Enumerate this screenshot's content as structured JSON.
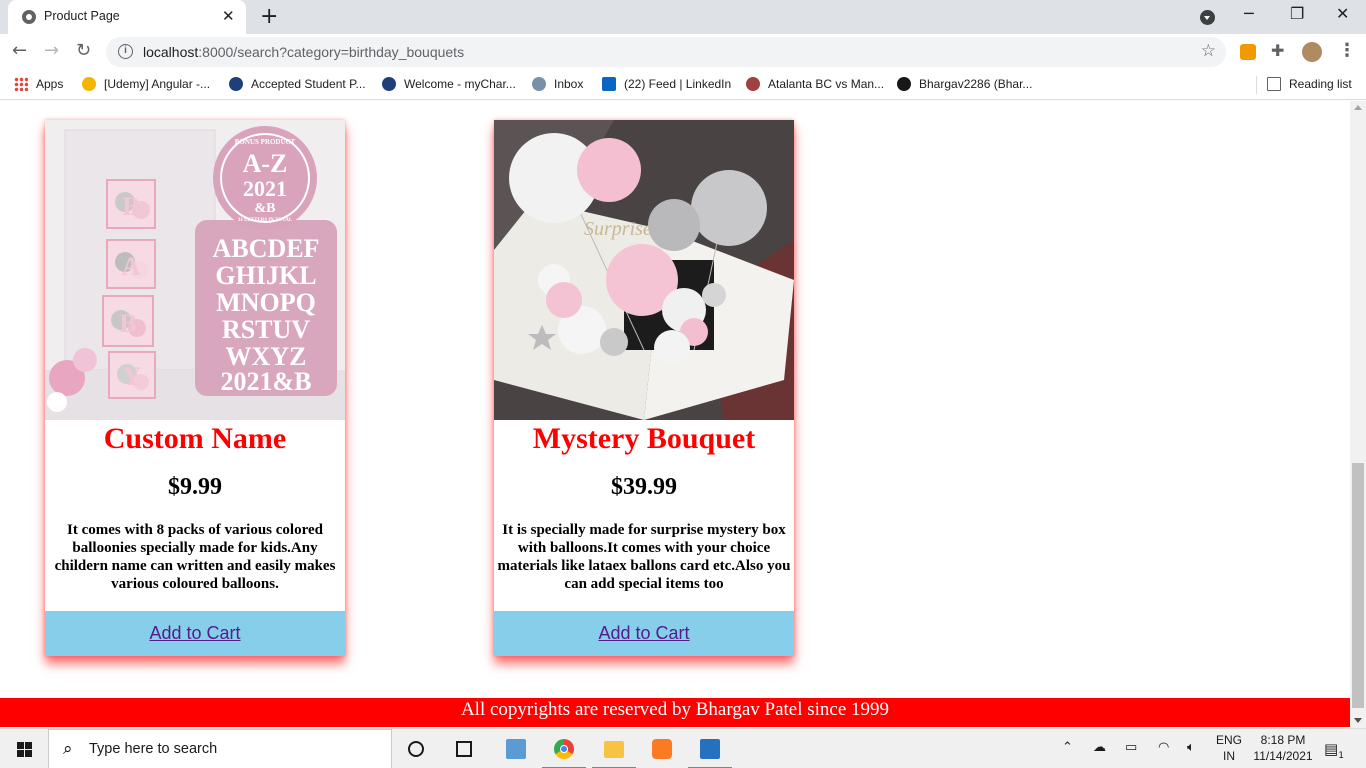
{
  "browser": {
    "tab_title": "Product Page",
    "tab_close": "✕",
    "new_tab": "+",
    "url_host": "localhost",
    "url_rest": ":8000/search?category=birthday_bouquets",
    "minimize": "─",
    "restore": "❐",
    "close": "✕",
    "bookmarks": [
      {
        "label": "Apps",
        "icon": "apps-grid-icon",
        "color": "#4285f4"
      },
      {
        "label": "[Udemy] Angular -...",
        "icon": "lightbulb-icon",
        "color": "#f4b400"
      },
      {
        "label": "Accepted Student P...",
        "icon": "university-seal-icon",
        "color": "#1f3f7a"
      },
      {
        "label": "Welcome - myChar...",
        "icon": "university-seal-icon",
        "color": "#1f3f7a"
      },
      {
        "label": "Inbox",
        "icon": "mail-icon",
        "color": "#7b8fa6"
      },
      {
        "label": "(22) Feed | LinkedIn",
        "icon": "linkedin-icon",
        "color": "#0a66c2"
      },
      {
        "label": "Atalanta BC vs Man...",
        "icon": "sports-icon",
        "color": "#a04040"
      },
      {
        "label": "Bhargav2286 (Bhar...",
        "icon": "github-icon",
        "color": "#181717"
      }
    ],
    "reading_list": "Reading list"
  },
  "products": [
    {
      "name": "Custom Name",
      "price": "$9.99",
      "description": "It comes with 8 packs of various colored balloonies specially made for kids.Any childern name can written and easily makes various coloured balloons.",
      "cart_label": "Add to Cart",
      "image_text": {
        "badge_top": "BONUS PRODUCT",
        "badge_main": "A-Z",
        "badge_year": "2021",
        "badge_amp": "&B",
        "badge_bottom": "31 LETTERS IN TOTAL",
        "letters": [
          "ABCDEF",
          "GHIJKL",
          "MNOPQ",
          "RSTUV",
          "WXYZ",
          "2021&B"
        ],
        "blocks": [
          "B",
          "A",
          "B",
          "Y"
        ]
      }
    },
    {
      "name": "Mystery Bouquet",
      "price": "$39.99",
      "description": "It is specially made for surprise mystery box with balloons.It comes with your choice materials like lataex ballons card etc.Also you can add special items too",
      "cart_label": "Add to Cart",
      "image_text": {
        "script": "Surprise"
      }
    }
  ],
  "footer": "All copyrights are reserved by Bhargav Patel since 1999",
  "taskbar": {
    "search_placeholder": "Type here to search",
    "language_top": "ENG",
    "language_bottom": "IN",
    "time": "8:18 PM",
    "date": "11/14/2021",
    "notification_count": "1"
  },
  "colors": {
    "product_name": "#ff0000",
    "cart_button": "#87ceeb",
    "footer": "#ff0000",
    "card_shadow": "#ff0000"
  }
}
